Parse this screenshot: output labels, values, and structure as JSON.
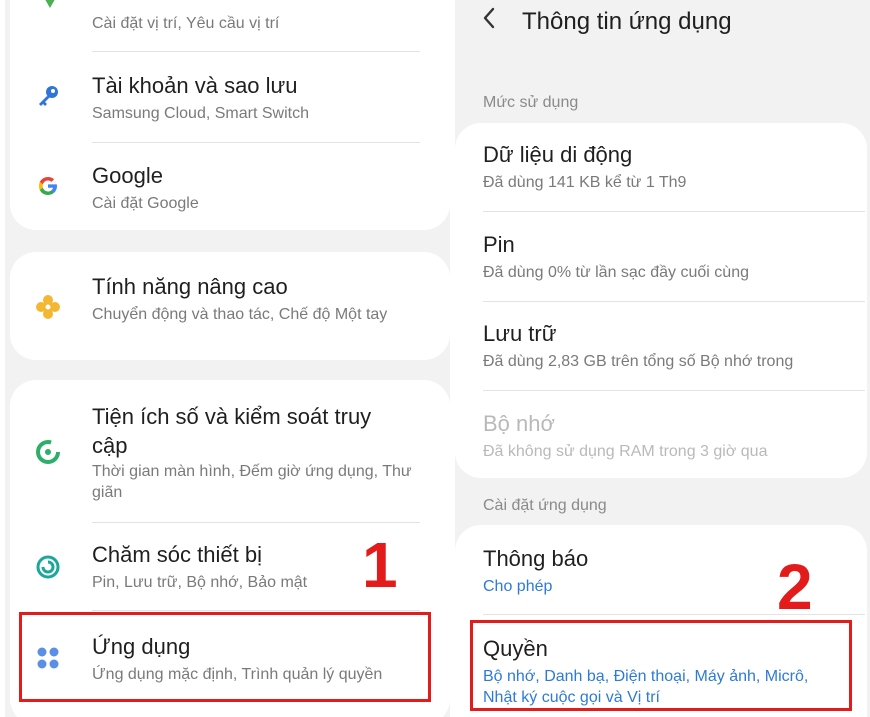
{
  "left": {
    "items": [
      {
        "subtitle": "Cài đặt vị trí, Yêu cầu vị trí"
      },
      {
        "title": "Tài khoản và sao lưu",
        "subtitle": "Samsung Cloud, Smart Switch"
      },
      {
        "title": "Google",
        "subtitle": "Cài đặt Google"
      },
      {
        "title": "Tính năng nâng cao",
        "subtitle": "Chuyển động và thao tác, Chế độ Một tay"
      },
      {
        "title": "Tiện ích số và kiểm soát truy cập",
        "subtitle": "Thời gian màn hình, Đếm giờ ứng dụng, Thư giãn"
      },
      {
        "title": "Chăm sóc thiết bị",
        "subtitle": "Pin, Lưu trữ, Bộ nhớ, Bảo mật"
      },
      {
        "title": "Ứng dụng",
        "subtitle": "Ứng dụng mặc định, Trình quản lý quyền"
      }
    ],
    "step_number": "1"
  },
  "right": {
    "header_title": "Thông tin ứng dụng",
    "section_usage": "Mức sử dụng",
    "usage_items": [
      {
        "title": "Dữ liệu di động",
        "subtitle": "Đã dùng 141 KB kể từ 1 Th9"
      },
      {
        "title": "Pin",
        "subtitle": "Đã dùng 0% từ lần sạc đầy cuối cùng"
      },
      {
        "title": "Lưu trữ",
        "subtitle": "Đã dùng 2,83 GB trên tổng số Bộ nhớ trong"
      },
      {
        "title": "Bộ nhớ",
        "subtitle": "Đã không sử dụng RAM trong 3 giờ qua"
      }
    ],
    "section_settings": "Cài đặt ứng dụng",
    "settings_items": [
      {
        "title": "Thông báo",
        "subtitle": "Cho phép"
      },
      {
        "title": "Quyền",
        "subtitle": "Bộ nhớ, Danh bạ, Điện thoại, Máy ảnh, Micrô, Nhật ký cuộc gọi và Vị trí"
      }
    ],
    "step_number": "2"
  },
  "colors": {
    "highlight": "#e31b1b",
    "link": "#2d7bd6",
    "background": "#f2f2f2",
    "card": "#ffffff"
  },
  "icons": {
    "location": "location-pin-icon",
    "accounts": "key-icon",
    "google": "google-g-icon",
    "advanced": "gear-flower-icon",
    "wellbeing": "wellbeing-icon",
    "device_care": "device-care-icon",
    "apps": "apps-grid-icon",
    "back": "back-arrow-icon"
  }
}
